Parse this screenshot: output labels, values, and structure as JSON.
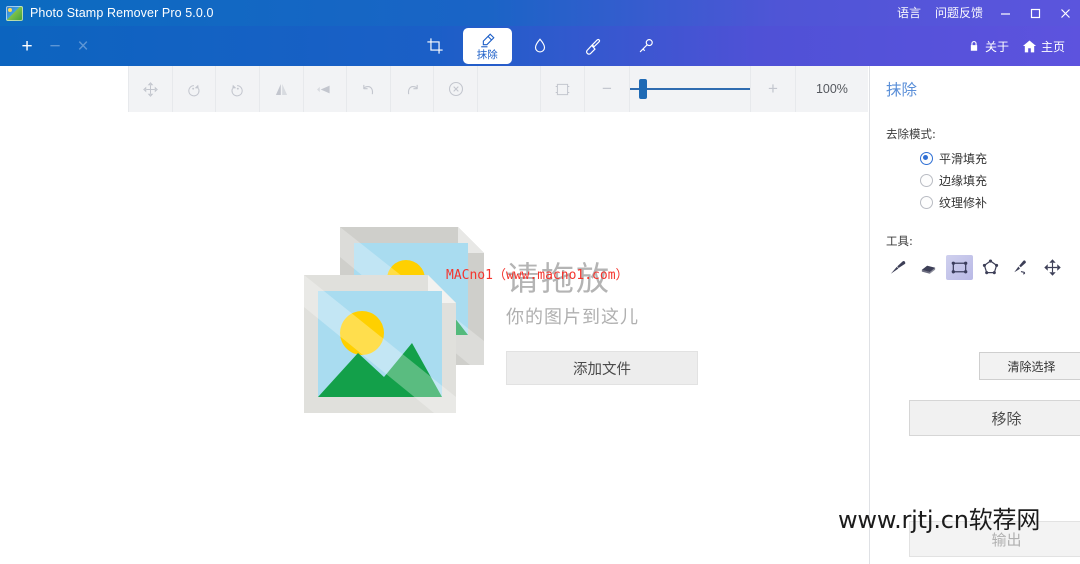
{
  "window": {
    "title": "Photo Stamp Remover Pro 5.0.0",
    "app_icon": "photo-icon",
    "language_label": "语言",
    "feedback_label": "问题反馈",
    "minimize": "minimize-icon",
    "maximize": "maximize-icon",
    "close": "close-icon",
    "accent_blue": "#0c64bf",
    "accent_violet": "#5d53de"
  },
  "navbar": {
    "file_add": "+",
    "file_remove": "−",
    "file_clear": "×",
    "tabs": [
      {
        "label": "",
        "icon": "crop-icon",
        "active": false
      },
      {
        "label": "抹除",
        "icon": "eraser-pencil-icon",
        "active": true
      },
      {
        "label": "",
        "icon": "water-drop-icon",
        "active": false
      },
      {
        "label": "",
        "icon": "paint-brush-icon",
        "active": false
      },
      {
        "label": "",
        "icon": "magic-wand-icon",
        "active": false
      }
    ],
    "about_label": "关于",
    "about_icon": "lock-icon",
    "home_label": "主页",
    "home_icon": "home-icon"
  },
  "toolbar": {
    "buttons": [
      {
        "name": "move",
        "icon": "move-arrows-icon",
        "enabled": false
      },
      {
        "name": "rotate-left",
        "icon": "rotate-left-icon",
        "enabled": false
      },
      {
        "name": "rotate-right",
        "icon": "rotate-right-icon",
        "enabled": false
      },
      {
        "name": "flip-horizontal",
        "icon": "flip-horizontal-icon",
        "enabled": false
      },
      {
        "name": "flip-vertical",
        "icon": "flip-vertical-icon",
        "enabled": false
      },
      {
        "name": "undo",
        "icon": "undo-icon",
        "enabled": false
      },
      {
        "name": "redo",
        "icon": "redo-icon",
        "enabled": false
      },
      {
        "name": "cancel",
        "icon": "circle-x-icon",
        "enabled": false
      }
    ],
    "fit_icon": "fit-to-screen-icon",
    "zoom_out": "−",
    "zoom_in": "+",
    "zoom_value": "100%",
    "zoom_percent": 100,
    "slider_position_percent": 8
  },
  "canvas": {
    "drop_title": "请拖放",
    "drop_subtitle": "你的图片到这儿",
    "add_file_label": "添加文件",
    "placeholder_icon": "stacked-photos-icon",
    "watermark_red": "MACno1（www.macno1.com）",
    "watermark_red_color": "#f4352e"
  },
  "panel": {
    "title": "抹除",
    "mode_label": "去除模式:",
    "modes": [
      {
        "label": "平滑填充",
        "selected": true
      },
      {
        "label": "边缘填充",
        "selected": false
      },
      {
        "label": "纹理修补",
        "selected": false
      }
    ],
    "tools_label": "工具:",
    "tools": [
      {
        "name": "brush",
        "icon": "paint-brush-icon",
        "selected": false
      },
      {
        "name": "eraser",
        "icon": "eraser-icon",
        "selected": false
      },
      {
        "name": "rectangle",
        "icon": "rectangle-select-icon",
        "selected": true
      },
      {
        "name": "polygon",
        "icon": "polygon-select-icon",
        "selected": false
      },
      {
        "name": "lasso",
        "icon": "lasso-select-icon",
        "selected": false
      },
      {
        "name": "move",
        "icon": "move-arrows-icon",
        "selected": false
      }
    ],
    "clear_selection_label": "清除选择",
    "remove_label": "移除",
    "output_label": "输出",
    "title_color": "#5a8fd8"
  },
  "overlay": {
    "site_watermark": "www.rjtj.cn软荐网"
  }
}
